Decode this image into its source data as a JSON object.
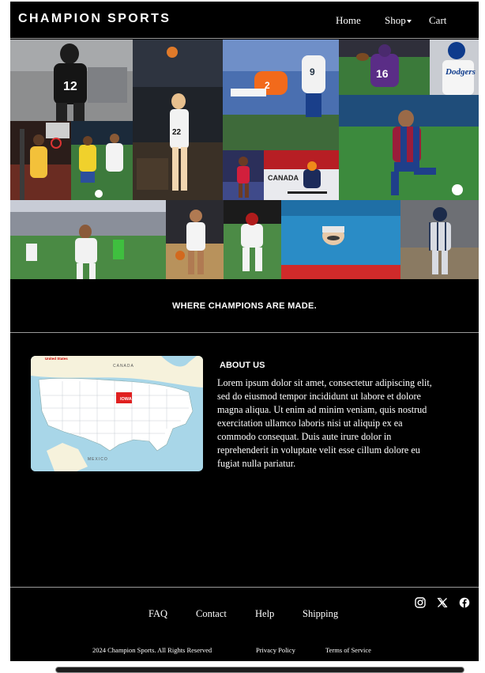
{
  "header": {
    "logo": "CHAMPION SPORTS",
    "nav": {
      "home": "Home",
      "shop": "Shop",
      "cart": "Cart"
    }
  },
  "hero": {
    "tiles": [
      {
        "name": "football-player-12-photo"
      },
      {
        "name": "basketball-shooter-22-photo"
      },
      {
        "name": "football-runner-2-photo"
      },
      {
        "name": "football-player-16-photo"
      },
      {
        "name": "baseball-dodgers-photo"
      },
      {
        "name": "basketball-dunk-photo"
      },
      {
        "name": "soccer-women-photo"
      },
      {
        "name": "football-catch-photo"
      },
      {
        "name": "soccer-player-barcelona-photo"
      },
      {
        "name": "tennis-player-photo"
      },
      {
        "name": "hockey-player-photo"
      },
      {
        "name": "soccer-stadium-photo"
      },
      {
        "name": "basketball-guard-photo"
      },
      {
        "name": "football-tackle-photo"
      },
      {
        "name": "swimmer-photo"
      },
      {
        "name": "baseball-yankees-photo"
      }
    ]
  },
  "tagline": "WHERE CHAMPIONS ARE MADE.",
  "about": {
    "title": "ABOUT US",
    "text": "Lorem ipsum dolor sit amet, consectetur adipiscing elit, sed do eiusmod tempor incididunt ut labore et dolore magna aliqua. Ut enim ad minim veniam, quis nostrud exercitation ullamco laboris nisi ut aliquip ex ea commodo consequat. Duis aute irure dolor in reprehenderit in voluptate velit esse cillum dolore eu fugiat nulla pariatur.",
    "map": {
      "heading": "United States",
      "canada": "CANADA",
      "mexico": "MEXICO",
      "highlight": "IOWA",
      "highlight_color": "#e02020"
    }
  },
  "footer": {
    "links": {
      "faq": "FAQ",
      "contact": "Contact",
      "help": "Help",
      "shipping": "Shipping"
    },
    "social": [
      "instagram-icon",
      "x-icon",
      "facebook-icon"
    ],
    "copyright": "2024 Champion Sports. All Rights Reserved",
    "privacy": "Privacy Policy",
    "terms": "Terms of Service"
  },
  "colors": {
    "background": "#000000",
    "text": "#ffffff",
    "rule": "#9a9a9a"
  }
}
